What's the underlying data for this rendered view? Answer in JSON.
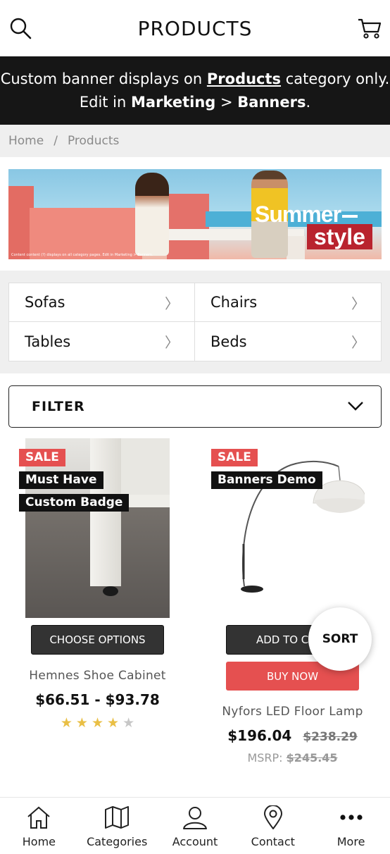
{
  "header": {
    "title": "PRODUCTS",
    "search_icon": "search-icon",
    "cart_icon": "cart-icon"
  },
  "promo": {
    "line1_pre": "Custom banner displays on ",
    "line1_link": "Products",
    "line1_post": " category only.",
    "line2_pre": "Edit in ",
    "line2_bold1": "Marketing",
    "line2_mid": " > ",
    "line2_bold2": "Banners",
    "line2_post": "."
  },
  "breadcrumb": {
    "home": "Home",
    "separator": "/",
    "current": "Products"
  },
  "hero": {
    "word1": "Summer",
    "word2": "style",
    "fine_print": "Content content (?) displays on all category pages. Edit in Marketing > Banners."
  },
  "categories": [
    {
      "label": "Sofas",
      "chevron": "〉"
    },
    {
      "label": "Chairs",
      "chevron": "〉"
    },
    {
      "label": "Tables",
      "chevron": "〉"
    },
    {
      "label": "Beds",
      "chevron": "〉"
    }
  ],
  "filter": {
    "label": "FILTER",
    "icon": "chevron-down-icon"
  },
  "products": [
    {
      "badges": [
        "SALE",
        "Must Have",
        "Custom Badge"
      ],
      "button": "CHOOSE OPTIONS",
      "name": "Hemnes Shoe Cabinet",
      "price": "$66.51 - $93.78",
      "rating": 4,
      "rating_max": 5
    },
    {
      "badges": [
        "SALE",
        "Banners Demo"
      ],
      "button": "ADD TO CART",
      "button2": "BUY NOW",
      "name": "Nyfors LED Floor Lamp",
      "price": "$196.04",
      "was_price": "$238.29",
      "msrp_label": "MSRP:",
      "msrp_value": "$245.45"
    }
  ],
  "sort": {
    "label": "SORT"
  },
  "tabbar": [
    {
      "label": "Home",
      "icon": "home-icon"
    },
    {
      "label": "Categories",
      "icon": "map-icon"
    },
    {
      "label": "Account",
      "icon": "user-icon"
    },
    {
      "label": "Contact",
      "icon": "location-pin-icon"
    },
    {
      "label": "More",
      "icon": "more-dots-icon"
    }
  ],
  "colors": {
    "banner_bg": "#161616",
    "sale": "#e55050",
    "star": "#e9bf45",
    "dark_button": "#333333"
  }
}
